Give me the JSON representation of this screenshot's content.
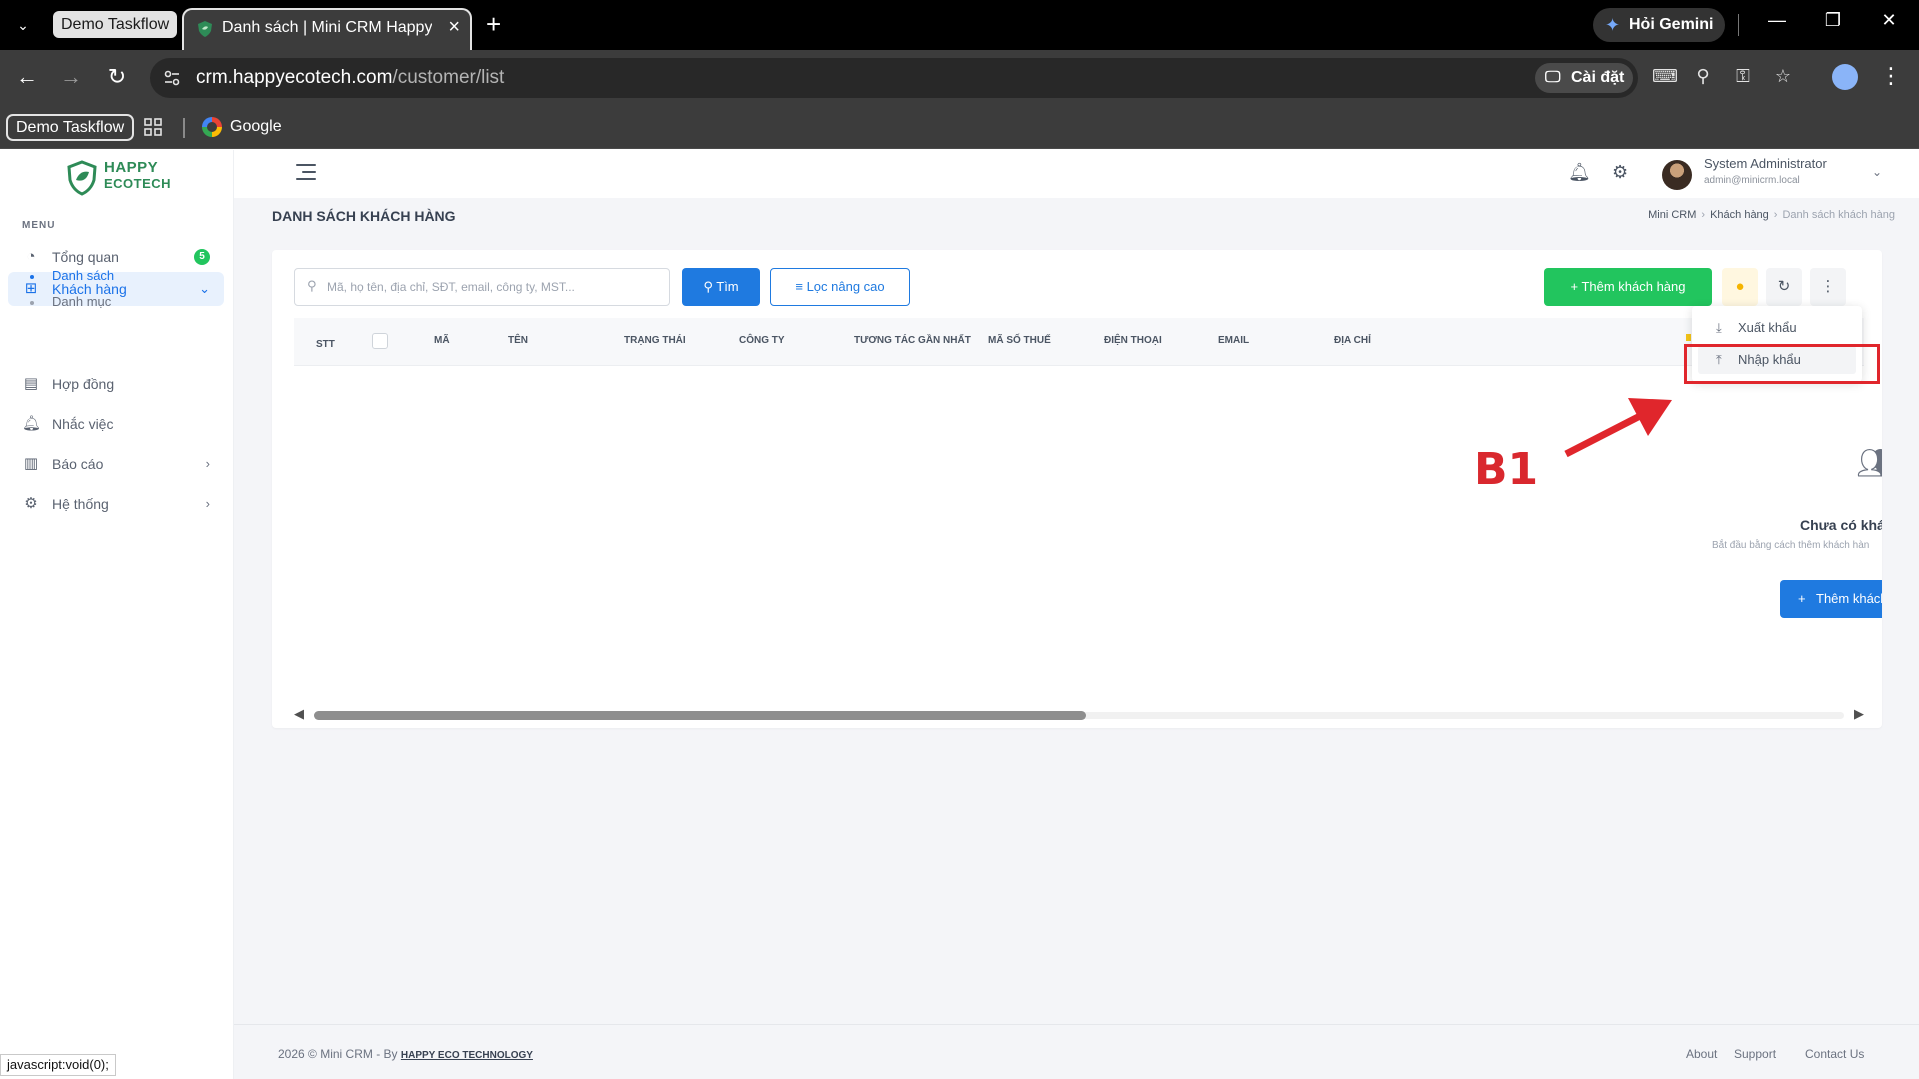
{
  "browser": {
    "tab_group_label": "Demo Taskflow",
    "active_tab_title": "Danh sách | Mini CRM Happy Ec",
    "gemini_label": "Hỏi Gemini",
    "url_host": "crm.happyecotech.com",
    "url_path": "/customer/list",
    "install_label": "Cài đặt",
    "bookmarks": {
      "group_label": "Demo Taskflow",
      "google_label": "Google"
    },
    "status_tooltip": "javascript:void(0);"
  },
  "sidebar": {
    "logo_line1": "HAPPY",
    "logo_line2": "ECOTECH",
    "menu_caption": "MENU",
    "items": [
      {
        "label": "Tổng quan",
        "badge": "5"
      },
      {
        "label": "Khách hàng"
      },
      {
        "label": "Hợp đồng"
      },
      {
        "label": "Nhắc việc"
      },
      {
        "label": "Báo cáo"
      },
      {
        "label": "Hệ thống"
      }
    ],
    "subitems": [
      {
        "label": "Danh sách"
      },
      {
        "label": "Danh mục"
      }
    ]
  },
  "topbar": {
    "user_name": "System Administrator",
    "user_email": "admin@minicrm.local"
  },
  "page": {
    "title": "DANH SÁCH KHÁCH HÀNG",
    "breadcrumb": [
      "Mini CRM",
      "Khách hàng",
      "Danh sách khách hàng"
    ]
  },
  "toolbar": {
    "search_placeholder": "Mã, họ tên, địa chỉ, SĐT, email, công ty, MST...",
    "find_label": "Tìm",
    "filter_label": "Lọc nâng cao",
    "add_label": "Thêm khách hàng"
  },
  "table": {
    "columns": [
      "STT",
      "MÃ",
      "TÊN",
      "TRẠNG THÁI",
      "CÔNG TY",
      "TƯƠNG TÁC GẦN NHẤT",
      "MÃ SỐ THUẾ",
      "ĐIỆN THOẠI",
      "EMAIL",
      "ĐỊA CHỈ"
    ]
  },
  "dropdown": {
    "export_label": "Xuất khẩu",
    "import_label": "Nhập khẩu"
  },
  "empty_state": {
    "title": "Chưa có khách",
    "subtitle": "Bắt đầu bằng cách thêm khách hàn",
    "button_label": "Thêm khách"
  },
  "annotation": {
    "label": "B1",
    "color": "#e0262c"
  },
  "footer": {
    "copyright": "2026 © Mini CRM - By ",
    "company": "HAPPY ECO TECHNOLOGY",
    "links": [
      "About",
      "Support",
      "Contact Us"
    ]
  },
  "colors": {
    "primary": "#1f7ae0",
    "success": "#22c55e",
    "brand": "#2e8b57"
  }
}
